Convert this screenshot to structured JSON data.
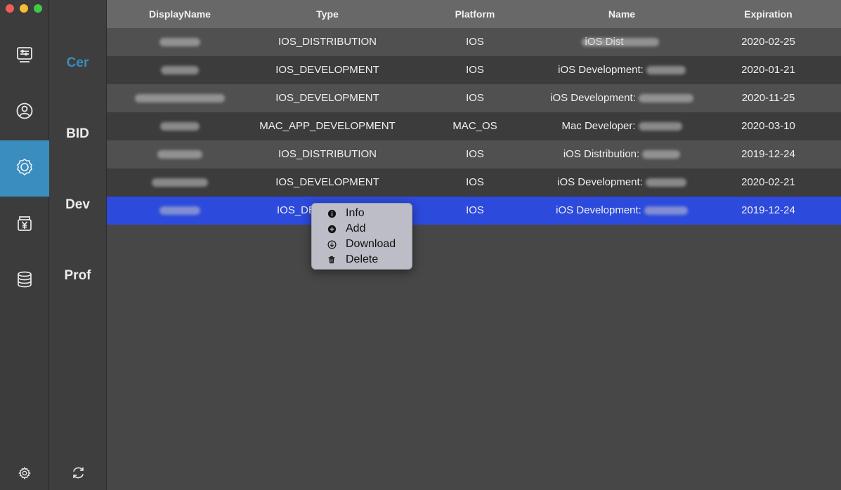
{
  "window": {
    "traffic_lights": {
      "close": "#ee5e57",
      "minimize": "#f5bd34",
      "maximize": "#3fc949"
    }
  },
  "sidebar": {
    "accent": "#3a8dbf",
    "items": [
      {
        "icon": "list-window-icon",
        "active": false
      },
      {
        "icon": "user-circle-icon",
        "active": false
      },
      {
        "icon": "certificate-badge-icon",
        "active": true
      },
      {
        "icon": "yen-box-icon",
        "active": false
      },
      {
        "icon": "database-icon",
        "active": false
      }
    ],
    "bottom_icon": "gear-icon"
  },
  "subnav": {
    "items": [
      {
        "label": "Cer",
        "active": true
      },
      {
        "label": "BID",
        "active": false
      },
      {
        "label": "Dev",
        "active": false
      },
      {
        "label": "Prof",
        "active": false
      }
    ],
    "bottom_icon": "refresh-icon"
  },
  "table": {
    "columns": [
      "DisplayName",
      "Type",
      "Platform",
      "Name",
      "Expiration"
    ],
    "rows": [
      {
        "display_name": "",
        "type": "IOS_DISTRIBUTION",
        "platform": "IOS",
        "name": "iOS Dist",
        "expiration": "2020-02-25"
      },
      {
        "display_name": "",
        "type": "IOS_DEVELOPMENT",
        "platform": "IOS",
        "name": "iOS Development:",
        "expiration": "2020-01-21"
      },
      {
        "display_name": "",
        "type": "IOS_DEVELOPMENT",
        "platform": "IOS",
        "name": "iOS Development:",
        "expiration": "2020-11-25"
      },
      {
        "display_name": "",
        "type": "MAC_APP_DEVELOPMENT",
        "platform": "MAC_OS",
        "name": "Mac Developer:",
        "expiration": "2020-03-10"
      },
      {
        "display_name": "",
        "type": "IOS_DISTRIBUTION",
        "platform": "IOS",
        "name": "iOS Distribution:",
        "expiration": "2019-12-24"
      },
      {
        "display_name": "",
        "type": "IOS_DEVELOPMENT",
        "platform": "IOS",
        "name": "iOS Development:",
        "expiration": "2020-02-21"
      },
      {
        "display_name": "",
        "type": "IOS_DE",
        "platform": "IOS",
        "name": "iOS Development:",
        "expiration": "2019-12-24"
      }
    ],
    "selected_row_index": 6,
    "selected_color": "#2c4adc"
  },
  "context_menu": {
    "items": [
      {
        "label": "Info",
        "icon": "info-icon"
      },
      {
        "label": "Add",
        "icon": "add-icon"
      },
      {
        "label": "Download",
        "icon": "download-icon"
      },
      {
        "label": "Delete",
        "icon": "trash-icon"
      }
    ]
  }
}
